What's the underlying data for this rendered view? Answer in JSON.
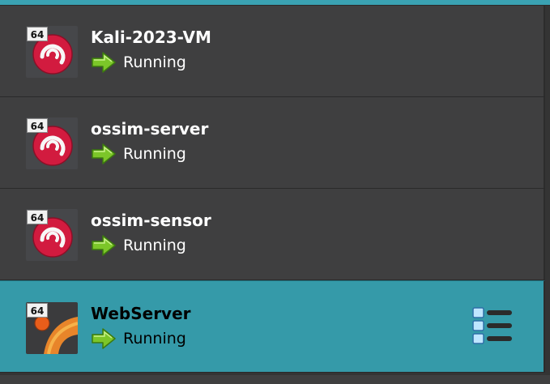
{
  "vm_list": {
    "items": [
      {
        "badge": "64",
        "name": "Kali-2023-VM",
        "state": "Running",
        "os_icon": "debian-swirl-icon",
        "selected": false
      },
      {
        "badge": "64",
        "name": "ossim-server",
        "state": "Running",
        "os_icon": "debian-swirl-icon",
        "selected": false
      },
      {
        "badge": "64",
        "name": "ossim-sensor",
        "state": "Running",
        "os_icon": "debian-swirl-icon",
        "selected": false
      },
      {
        "badge": "64",
        "name": "WebServer",
        "state": "Running",
        "os_icon": "ubuntu-icon",
        "selected": true
      }
    ],
    "state_icon": "green-arrow-icon",
    "tools_icon": "tools-menu-icon"
  },
  "colors": {
    "list_background": "#3f3f40",
    "selected_background": "#359aa9",
    "name_text": "#ffffff",
    "selected_text": "#000000",
    "running_arrow": "#7cc629"
  }
}
